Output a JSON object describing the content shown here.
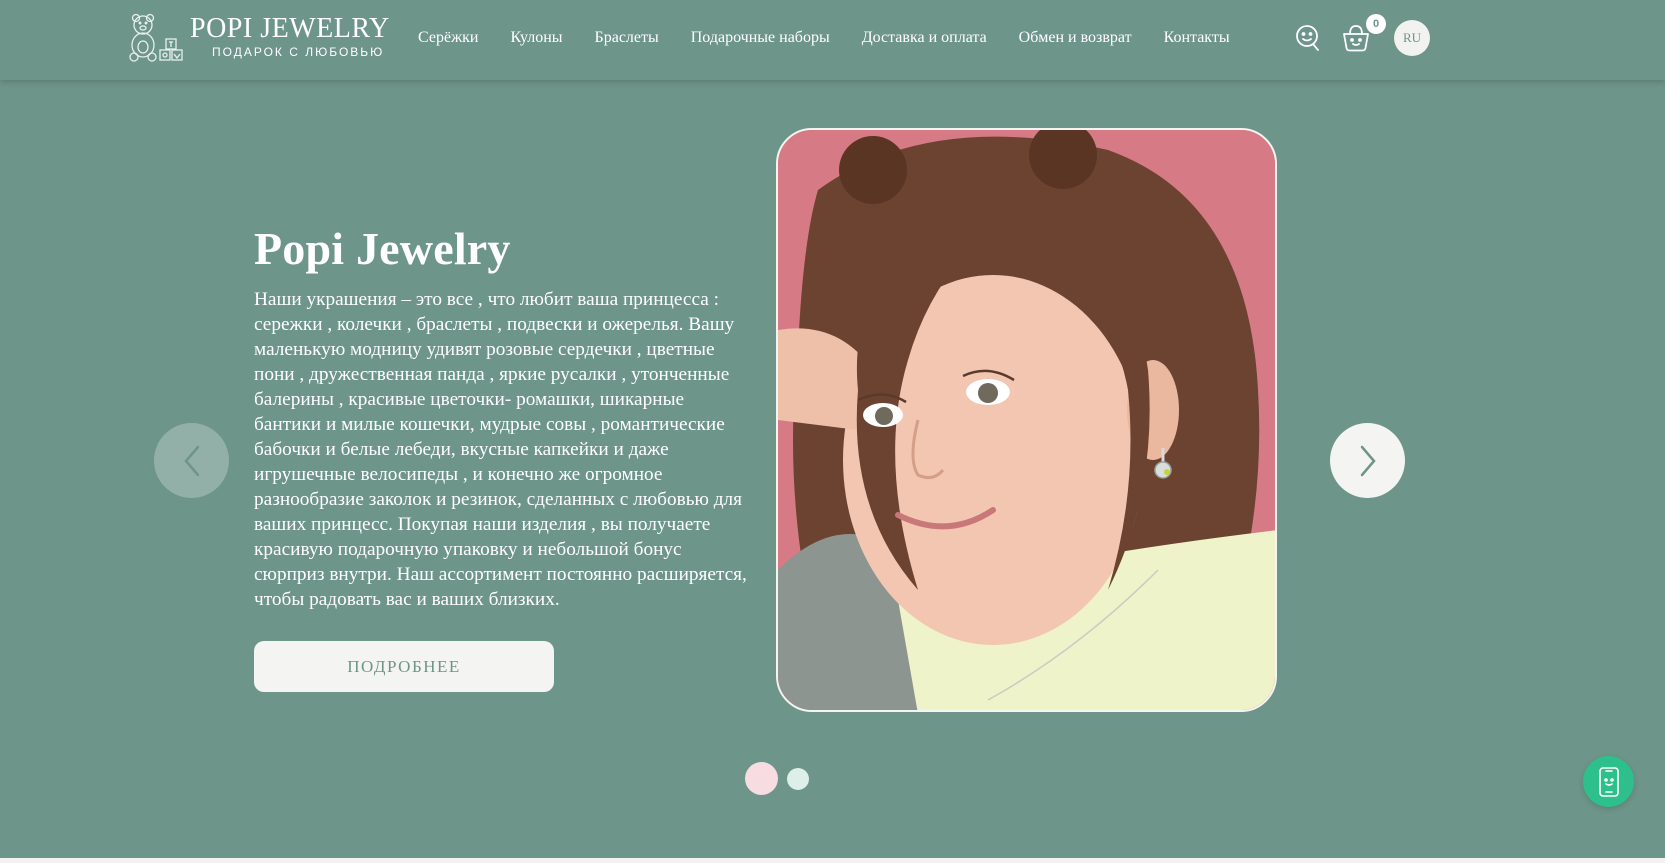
{
  "colors": {
    "background": "#6e958a",
    "light": "#f4f4f2",
    "accent_pink": "#f7dde2",
    "accent_mint": "#dcefe8",
    "chat": "#2dbf8c"
  },
  "header": {
    "logo_icon": "teddy-bear-with-blocks-icon",
    "brand": "POPI JEWELRY",
    "tagline": "ПОДАРОК С ЛЮБОВЬЮ",
    "nav": [
      {
        "label": "Серёжки"
      },
      {
        "label": "Кулоны"
      },
      {
        "label": "Браслеты"
      },
      {
        "label": "Подарочные наборы"
      },
      {
        "label": "Доставка и оплата"
      },
      {
        "label": "Обмен и возврат"
      },
      {
        "label": "Контакты"
      }
    ],
    "search_icon": "search-icon",
    "cart_icon": "cart-icon",
    "cart_count": "0",
    "language": "RU"
  },
  "hero": {
    "title": "Popi Jewelry",
    "description": "Наши украшения – это все , что любит ваша принцесса : сережки , колечки , браслеты , подвески и ожерелья. Вашу маленькую модницу удивят розовые сердечки , цветные пони , дружественная панда , яркие русалки , утонченные балерины , красивые цветочки- ромашки, шикарные бантики и милые кошечки, мудрые совы , романтические бабочки и белые лебеди, вкусные капкейки и даже игрушечные велосипеды , и конечно же огромное разнообразие заколок и резинок, сделанных с любовью для ваших принцесс. Покупая наши изделия , вы получаете красивую подарочную упаковку и небольшой бонус сюрприз внутри. Наш ассортимент постоянно расширяется, чтобы радовать вас и ваших близких.",
    "button_label": "ПОДРОБНЕЕ",
    "image_subject": "girl-wearing-earring-photo"
  },
  "slider": {
    "prev_icon": "chevron-left-icon",
    "next_icon": "chevron-right-icon",
    "active_slide": 1,
    "slide_count": 2
  },
  "chat": {
    "icon": "phone-chat-icon"
  }
}
